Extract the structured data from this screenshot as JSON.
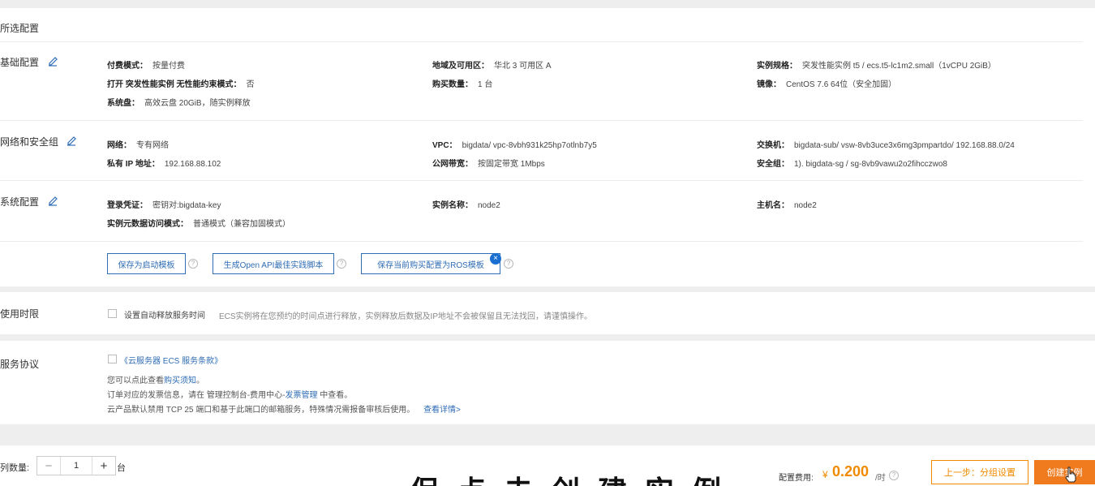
{
  "config": {
    "title": "所选配置",
    "basic": {
      "title": "基础配置",
      "items": [
        {
          "k": "付费模式：",
          "v": "按量付费"
        },
        {
          "k": "地域及可用区：",
          "v": "华北 3 可用区 A"
        },
        {
          "k": "实例规格：",
          "v": "突发性能实例 t5 / ecs.t5-lc1m2.small（1vCPU 2GiB）"
        },
        {
          "k": "打开 突发性能实例 无性能约束模式：",
          "v": "否"
        },
        {
          "k": "购买数量：",
          "v": "1 台"
        },
        {
          "k": "镜像：",
          "v": "CentOS 7.6 64位（安全加固）"
        },
        {
          "k": "系统盘：",
          "v": "高效云盘 20GiB，随实例释放"
        }
      ]
    },
    "network": {
      "title": "网络和安全组",
      "items": [
        {
          "k": "网络：",
          "v": "专有网络"
        },
        {
          "k": "VPC：",
          "v": "bigdata/ vpc-8vbh931k25hp7otlnb7y5"
        },
        {
          "k": "交换机：",
          "v": "bigdata-sub/ vsw-8vb3uce3x6mg3pmpartdo/ 192.168.88.0/24"
        },
        {
          "k": "私有 IP 地址：",
          "v": "192.168.88.102"
        },
        {
          "k": "公网带宽：",
          "v": "按固定带宽 1Mbps"
        },
        {
          "k": "安全组：",
          "v": "1). bigdata-sg / sg-8vb9vawu2o2fihcczwo8"
        }
      ]
    },
    "system": {
      "title": "系统配置",
      "items": [
        {
          "k": "登录凭证：",
          "v": "密钥对:bigdata-key"
        },
        {
          "k": "实例名称：",
          "v": "node2"
        },
        {
          "k": "主机名：",
          "v": "node2"
        },
        {
          "k": "实例元数据访问模式：",
          "v": "普通模式（兼容加固模式）"
        }
      ]
    },
    "buttons": {
      "save_template": "保存为启动模板",
      "gen_openapi": "生成Open API最佳实践脚本",
      "save_ros": "保存当前购买配置为ROS模板"
    }
  },
  "usage": {
    "title": "使用时限",
    "checkbox_label": "设置自动释放服务时间",
    "hint": "ECS实例将在您预约的时间点进行释放，实例释放后数据及IP地址不会被保留且无法找回，请谨慎操作。"
  },
  "agreement": {
    "title": "服务协议",
    "terms_link": "《云服务器 ECS 服务条款》",
    "line1_prefix": "您可以点此查看",
    "line1_link": "购买须知",
    "line1_suffix": "。",
    "line2_prefix": "订单对应的发票信息，请在 管理控制台-费用中心-",
    "line2_link": "发票管理",
    "line2_suffix": " 中查看。",
    "line3": "云产品默认禁用 TCP 25 端口和基于此端口的邮箱服务，特殊情况需报备审核后使用。",
    "line3_link": "查看详情>"
  },
  "footer": {
    "qty_label": "列数量:",
    "qty_value": "1",
    "qty_unit": "台",
    "fee_label": "配置费用:",
    "currency": "¥",
    "price": "0.200",
    "price_unit": "/时",
    "prev_button": "上一步：分组设置",
    "create_button": "创建实例"
  },
  "overlay_subtitle": "保 点 击 创 建 实 例"
}
